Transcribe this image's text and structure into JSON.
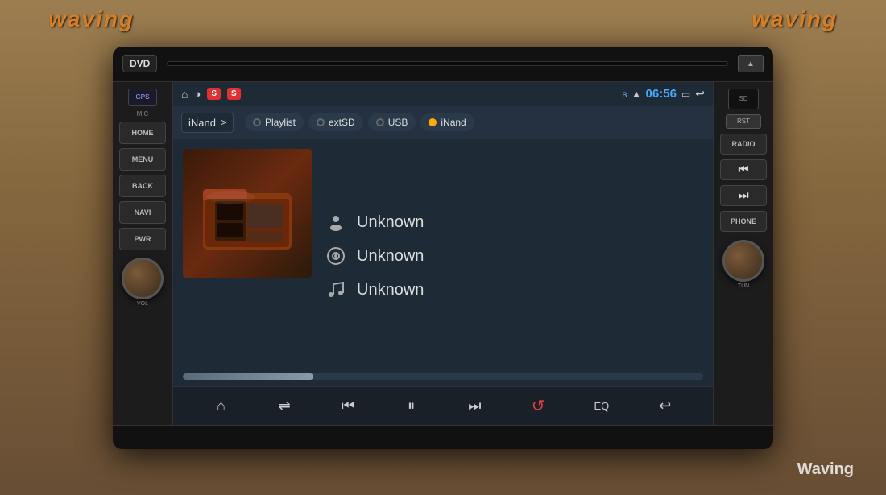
{
  "watermark": {
    "top_left": "waving",
    "top_right": "waving",
    "bottom_right": "Waving"
  },
  "device": {
    "top": {
      "dvd_label": "DVD",
      "eject_symbol": "▲",
      "sd_label": "SD"
    },
    "left_panel": {
      "gps_label": "GPS",
      "mic_label": "MIC",
      "buttons": [
        "HOME",
        "MENU",
        "BACK",
        "NAVI",
        "PWR"
      ],
      "vol_label": "VOL"
    },
    "right_panel": {
      "rst_label": "RST",
      "radio_label": "RADIO",
      "prev_symbol": "⏮",
      "next_symbol": "⏭",
      "phone_label": "PHONE",
      "tun_label": "TUN"
    }
  },
  "screen": {
    "status_bar": {
      "home_icon": "⌂",
      "brightness_icon": "◑",
      "ss_badge1": "S",
      "ss_badge2": "S",
      "bluetooth_icon": "ʙ",
      "wifi_icon": "▲",
      "time": "06:56",
      "screen_icon": "▭",
      "back_icon": "↩"
    },
    "source_bar": {
      "folder_label": "iNand",
      "folder_arrow": ">",
      "tabs": [
        {
          "label": "Playlist",
          "active": false
        },
        {
          "label": "extSD",
          "active": false
        },
        {
          "label": "USB",
          "active": false
        },
        {
          "label": "iNand",
          "active": true,
          "type": "inand"
        }
      ]
    },
    "track_info": {
      "artist": "Unknown",
      "album": "Unknown",
      "song": "Unknown",
      "artist_icon": "👤",
      "album_icon": "💿",
      "song_icon": "♪"
    },
    "progress": {
      "fill_percent": 25
    },
    "bottom_controls": {
      "home_icon": "⌂",
      "shuffle_icon": "⇌",
      "prev_icon": "⏮",
      "play_icon": "⏸",
      "next_icon": "⏭",
      "repeat_icon": "↺",
      "eq_label": "EQ",
      "back_icon": "↩"
    }
  }
}
